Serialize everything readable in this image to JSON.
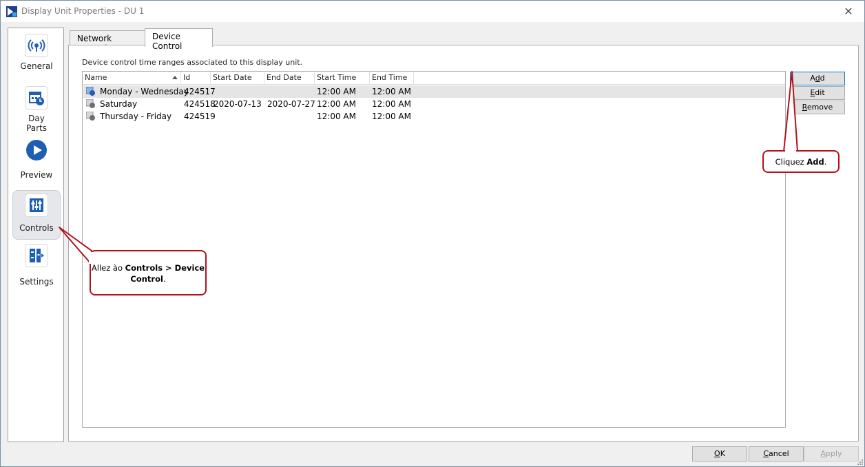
{
  "window": {
    "title": "Display Unit Properties - DU 1",
    "close_glyph": "✕"
  },
  "nav": {
    "items": [
      {
        "label": "General",
        "icon": "broadcast-icon"
      },
      {
        "label": "Day Parts",
        "line1": "Day",
        "line2": "Parts",
        "icon": "calendar-clock-icon"
      },
      {
        "label": "Preview",
        "icon": "play-icon"
      },
      {
        "label": "Controls",
        "icon": "sliders-icon"
      },
      {
        "label": "Settings",
        "icon": "settings-panel-icon"
      }
    ],
    "selected": "Controls"
  },
  "tabs": [
    {
      "label": "Network Control",
      "active": false
    },
    {
      "label": "Device Control",
      "active": true
    }
  ],
  "description": "Device control time ranges associated to this display unit.",
  "table": {
    "columns": [
      "Name",
      "Id",
      "Start Date",
      "End Date",
      "Start Time",
      "End Time"
    ],
    "sorted_column": "Name",
    "rows": [
      {
        "name": "Monday - Wednesday",
        "id": "424517",
        "start_date": "",
        "end_date": "",
        "start_time": "12:00 AM",
        "end_time": "12:00 AM",
        "selected": true
      },
      {
        "name": "Saturday",
        "id": "424518",
        "start_date": "2020-07-13",
        "end_date": "2020-07-27",
        "start_time": "12:00 AM",
        "end_time": "12:00 AM",
        "selected": false
      },
      {
        "name": "Thursday - Friday",
        "id": "424519",
        "start_date": "",
        "end_date": "",
        "start_time": "12:00 AM",
        "end_time": "12:00 AM",
        "selected": false
      }
    ]
  },
  "side_buttons": {
    "add": {
      "pre": "A",
      "mn": "d",
      "post": "d"
    },
    "edit": {
      "pre": "",
      "mn": "E",
      "post": "dit"
    },
    "remove": {
      "pre": "",
      "mn": "R",
      "post": "emove"
    }
  },
  "bottom_buttons": {
    "ok": {
      "pre": "",
      "mn": "O",
      "post": "K"
    },
    "cancel": {
      "pre": "",
      "mn": "C",
      "post": "ancel"
    },
    "apply": {
      "pre": "",
      "mn": "A",
      "post": "pply"
    }
  },
  "callouts": {
    "add": {
      "text": "Cliquez ",
      "bold": "Add",
      "end": "."
    },
    "controls": {
      "text1": "Allez àο ",
      "bold1": "Controls > Device",
      "bold2": "Control",
      "end": "."
    }
  },
  "colors": {
    "callout_border": "#b4111b",
    "accent": "#0078d7",
    "icon_blue": "#1e5fb4"
  }
}
